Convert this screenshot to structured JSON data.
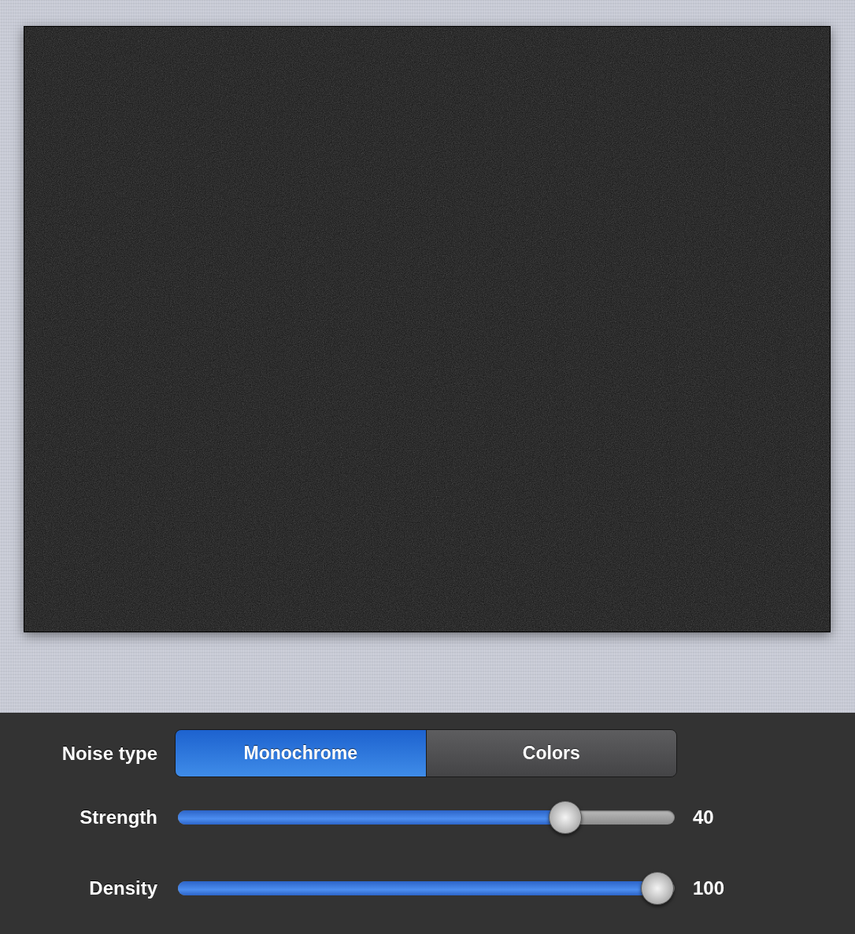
{
  "noise_type": {
    "label": "Noise type",
    "options": [
      {
        "label": "Monochrome",
        "selected": true
      },
      {
        "label": "Colors",
        "selected": false
      }
    ]
  },
  "sliders": [
    {
      "label": "Strength",
      "level": 0.78,
      "value": "40"
    },
    {
      "label": "Density",
      "level": 0.965,
      "value": "100"
    }
  ]
}
